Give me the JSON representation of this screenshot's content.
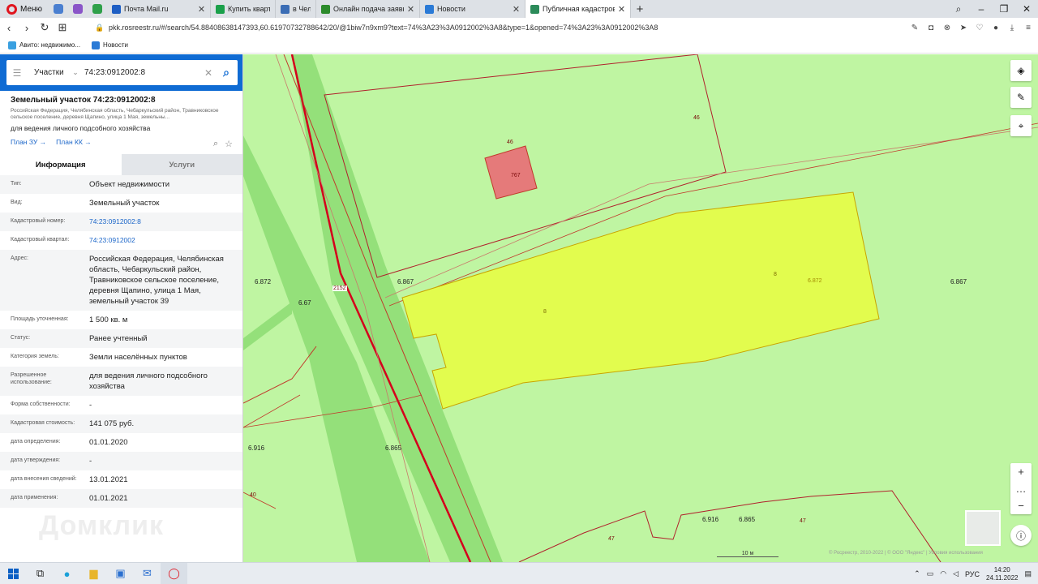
{
  "browser": {
    "menu_label": "Меню",
    "tabs": [
      {
        "title": "Почта Mail.ru",
        "color": "#1f5fc4"
      },
      {
        "title": "Купить квартиру",
        "color": "#1aa04a"
      },
      {
        "title": "в Чел",
        "color": "#3b6db5"
      },
      {
        "title": "Онлайн подача заявки на",
        "color": "#2c8b2c"
      },
      {
        "title": "Новости",
        "color": "#2a7ad6"
      },
      {
        "title": "Публичная кадастровая к",
        "color": "#2c8b5a"
      }
    ],
    "url": "pkk.rosreestr.ru/#/search/54.88408638147393,60.61970732788642/20/@1biw7n9xm9?text=74%3A23%3A0912002%3A8&type=1&opened=74%3A23%3A0912002%3A8",
    "bookmarks": [
      {
        "label": "Авито: недвижимо...",
        "color": "#3aa0e0"
      },
      {
        "label": "Новости",
        "color": "#2a7ad6"
      }
    ]
  },
  "search": {
    "type_label": "Участки",
    "value": "74:23:0912002:8"
  },
  "object": {
    "title": "Земельный участок 74:23:0912002:8",
    "address_short": "Российская Федерация, Челябинская область, Чебаркульский район, Травниковское сельское поселение, деревня Щапино, улица 1 Мая, земельны...",
    "use": "для ведения личного подсобного хозяйства",
    "plan_zu": "План ЗУ →",
    "plan_kk": "План КК →"
  },
  "tabs": {
    "info": "Информация",
    "services": "Услуги"
  },
  "properties": [
    {
      "label": "Тип:",
      "value": "Объект недвижимости",
      "link": false
    },
    {
      "label": "Вид:",
      "value": "Земельный участок",
      "link": false
    },
    {
      "label": "Кадастровый номер:",
      "value": "74:23:0912002:8",
      "link": true
    },
    {
      "label": "Кадастровый квартал:",
      "value": "74:23:0912002",
      "link": true
    },
    {
      "label": "Адрес:",
      "value": "Российская Федерация, Челябинская область, Чебаркульский район, Травниковское сельское поселение, деревня Щапино, улица 1 Мая, земельный участок 39",
      "link": false
    },
    {
      "label": "Площадь уточненная:",
      "value": "1 500 кв. м",
      "link": false
    },
    {
      "label": "Статус:",
      "value": "Ранее учтенный",
      "link": false
    },
    {
      "label": "Категория земель:",
      "value": "Земли населённых пунктов",
      "link": false
    },
    {
      "label": "Разрешенное использование:",
      "value": "для ведения личного подсобного хозяйства",
      "link": false
    },
    {
      "label": "Форма собственности:",
      "value": "-",
      "link": false
    },
    {
      "label": "Кадастровая стоимость:",
      "value": "141 075 руб.",
      "link": false
    },
    {
      "label": "дата определения:",
      "value": "01.01.2020",
      "link": false
    },
    {
      "label": "дата утверждения:",
      "value": "-",
      "link": false
    },
    {
      "label": "дата внесения сведений:",
      "value": "13.01.2021",
      "link": false
    },
    {
      "label": "дата применения:",
      "value": "01.01.2021",
      "link": false
    }
  ],
  "watermark": "Домклик",
  "map": {
    "labels": {
      "p46a": "46",
      "p46b": "46",
      "p767": "767",
      "l6872a": "6.872",
      "l6867a": "6.867",
      "l2152": "2152",
      "l667": "6.67",
      "l8a": "8",
      "l8b": "8",
      "l6872b": "6.872",
      "l6867b": "6.867",
      "l6916a": "6.916",
      "l6865a": "6.865",
      "l40": "40",
      "l6916b": "6.916",
      "l6865b": "6.865",
      "l47a": "47",
      "l47b": "47"
    },
    "scale": "10 м",
    "copyright": "© Росреестр, 2010-2022 | © ООО \"Яндекс\" | Условия использования"
  },
  "taskbar": {
    "lang": "РУС",
    "time": "14:20",
    "date": "24.11.2022"
  }
}
